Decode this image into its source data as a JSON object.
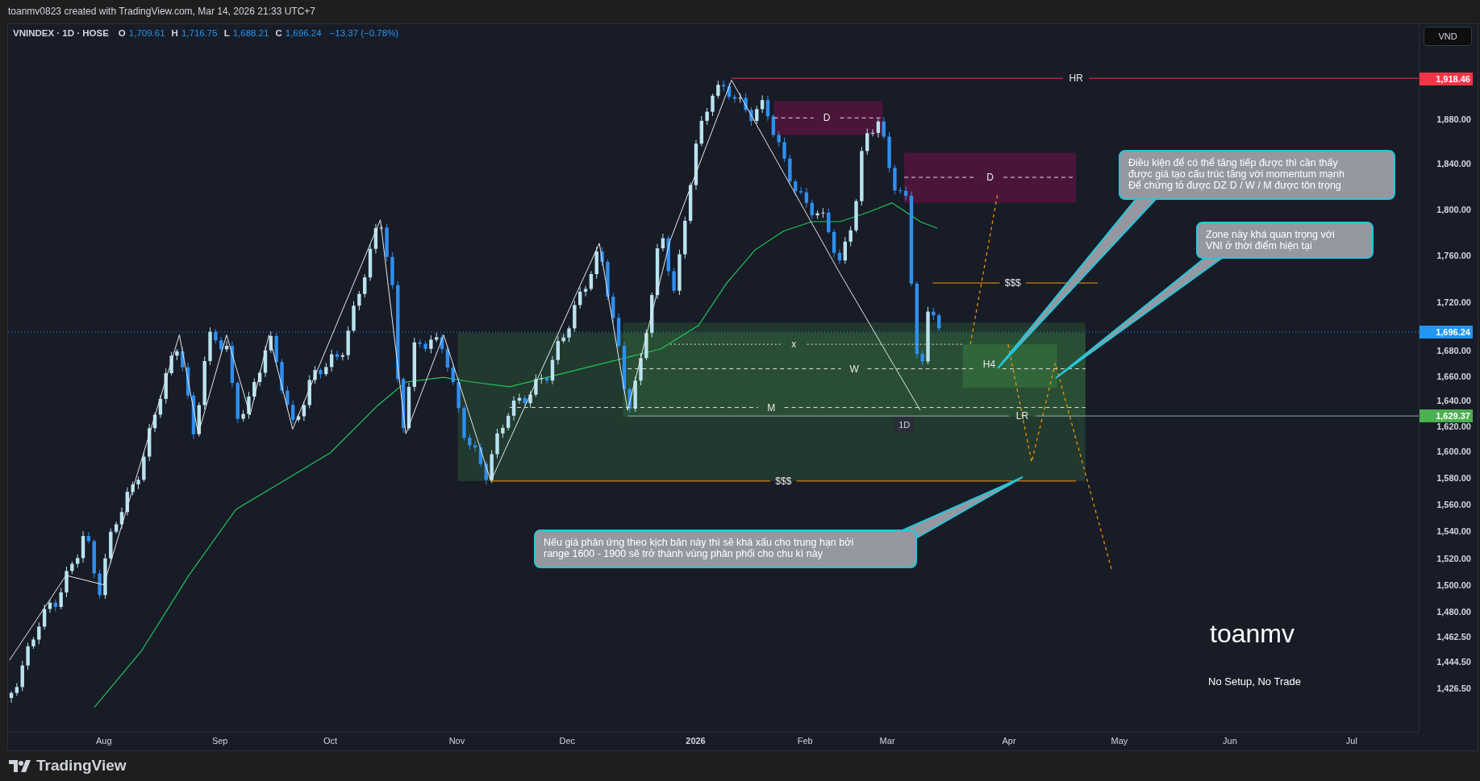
{
  "header": {
    "caption": "toanmv0823 created with TradingView.com, Mar 14, 2026 21:33 UTC+7"
  },
  "legend": {
    "symbol": "VNINDEX · 1D · HOSE",
    "ohlc": [
      {
        "label": "O",
        "value": "1,709.61"
      },
      {
        "label": "H",
        "value": "1,716.75"
      },
      {
        "label": "L",
        "value": "1,688.21"
      },
      {
        "label": "C",
        "value": "1,696.24"
      }
    ],
    "change": "−13.37 (−0.78%)"
  },
  "currency_button": "VND",
  "price_axis": {
    "labels": [
      "1,880.00",
      "1,840.00",
      "1,800.00",
      "1,760.00",
      "1,720.00",
      "1,680.00",
      "1,660.00",
      "1,640.00",
      "1,620.00",
      "1,600.00",
      "1,580.00",
      "1,560.00",
      "1,540.00",
      "1,520.00",
      "1,500.00",
      "1,480.00",
      "1,462.50",
      "1,444.50",
      "1,426.50"
    ],
    "badges": [
      {
        "text": "1,918.46",
        "color": "#f23645"
      },
      {
        "text": "1,696.24",
        "color": "#2196f3"
      },
      {
        "text": "1,629.37",
        "color": "#4caf50"
      }
    ]
  },
  "time_axis": {
    "labels": [
      {
        "text": "Aug",
        "year": false
      },
      {
        "text": "Sep",
        "year": false
      },
      {
        "text": "Oct",
        "year": false
      },
      {
        "text": "Nov",
        "year": false
      },
      {
        "text": "Dec",
        "year": false
      },
      {
        "text": "2026",
        "year": true
      },
      {
        "text": "Feb",
        "year": false
      },
      {
        "text": "Mar",
        "year": false
      },
      {
        "text": "Apr",
        "year": false
      },
      {
        "text": "May",
        "year": false
      },
      {
        "text": "Jun",
        "year": false
      },
      {
        "text": "Jul",
        "year": false
      }
    ]
  },
  "level_labels": [
    "HR",
    "D",
    "D",
    "$$$",
    "x",
    "H4",
    "W",
    "M",
    "LR",
    "$$$"
  ],
  "timeframe_tag": "1D",
  "callouts": [
    {
      "lines": [
        "Điều kiện để có thể tăng tiếp được thì cần thấy",
        "được giá tạo cấu trúc tăng với momentum mạnh",
        "Để chứng tỏ được DZ D / W / M được tôn trọng"
      ]
    },
    {
      "lines": [
        "Zone này khá quan trọng với",
        "VNI ở thời điểm hiện tại"
      ]
    },
    {
      "lines": [
        "Nếu giá phản ứng theo kịch bản này thì sẽ khá xấu cho trung hạn bởi",
        "range 1600 - 1900 sẽ trở thành vùng phân phối cho chu kì này"
      ]
    }
  ],
  "signature": "toanmv",
  "tagline": "No Setup, No Trade",
  "footer": {
    "brand": "TradingView"
  }
}
